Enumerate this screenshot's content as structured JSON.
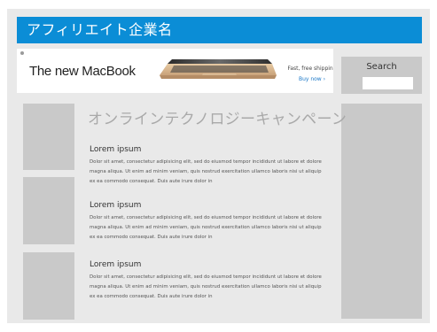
{
  "header": {
    "title": "アフィリエイト企業名"
  },
  "banner": {
    "headline": "The new MacBook",
    "shipping": "Fast, free shipping",
    "cta": "Buy now ›",
    "product_image": "laptop-image"
  },
  "search": {
    "label": "Search",
    "placeholder": ""
  },
  "main": {
    "title": "オンラインテクノロジーキャンペーン",
    "articles": [
      {
        "heading": "Lorem ipsum",
        "body": "Dolor sit amet, consectetur adipisicing elit, sed do eiusmod tempor incididunt ut labore et dolore magna aliqua. Ut enim ad minim veniam, quis nostrud exercitation ullamco laboris nisi ut aliquip ex ea commodo consequat. Duis aute irure dolor in"
      },
      {
        "heading": "Lorem ipsum",
        "body": "Dolor sit amet, consectetur adipisicing elit, sed do eiusmod tempor incididunt ut labore et dolore magna aliqua. Ut enim ad minim veniam, quis nostrud exercitation ullamco laboris nisi ut aliquip ex ea commodo consequat. Duis aute irure dolor in"
      },
      {
        "heading": "Lorem ipsum",
        "body": "Dolor sit amet, consectetur adipisicing elit, sed do eiusmod tempor incididunt ut labore et dolore magna aliqua. Ut enim ad minim veniam, quis nostrud exercitation ullamco laboris nisi ut aliquip ex ea commodo consequat. Duis aute irure dolor in"
      }
    ]
  },
  "colors": {
    "header_bg": "#0b8dd6",
    "page_bg": "#e9e9e9",
    "block_gray": "#c9c9c9",
    "title_gray": "#a9a9a9",
    "link_blue": "#1b78c8"
  }
}
